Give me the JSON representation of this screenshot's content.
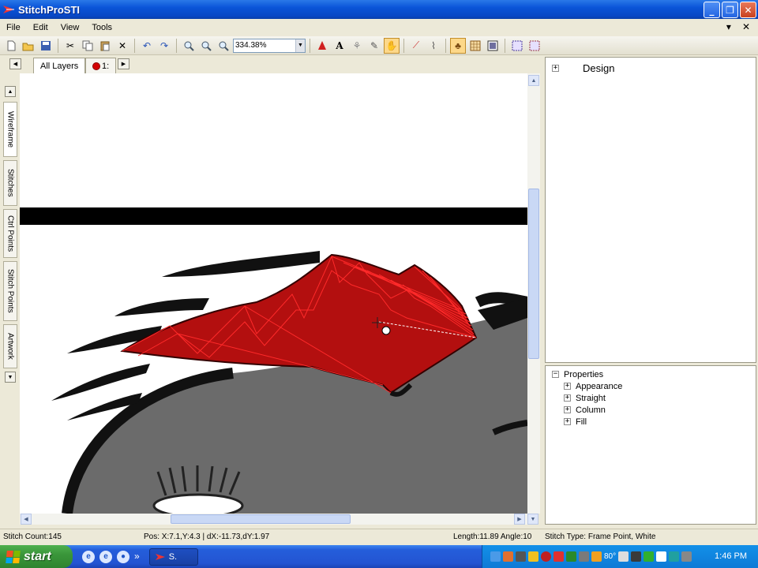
{
  "window": {
    "title": "StitchProSTI",
    "min_glyph": "_",
    "max_glyph": "❐",
    "close_glyph": "✕"
  },
  "menu": {
    "items": [
      "File",
      "Edit",
      "View",
      "Tools"
    ],
    "right_dropdown": "▾",
    "right_close": "✕"
  },
  "toolbar": {
    "zoom_value": "334.38%",
    "icons": [
      "new-icon",
      "open-icon",
      "save-icon",
      "cut-icon",
      "copy-icon",
      "paste-icon",
      "delete-icon",
      "undo-icon",
      "redo-icon",
      "zoom-in-icon",
      "zoom-out-icon",
      "zoom-fit-icon",
      "color-icon",
      "text-icon",
      "tool-a-icon",
      "tool-b-icon",
      "tool-c-icon",
      "line-icon",
      "node-icon",
      "view-a-icon",
      "view-b-icon",
      "view-c-icon",
      "grid-a-icon",
      "grid-b-icon"
    ]
  },
  "layers": {
    "tabs": [
      "All Layers",
      "1:"
    ],
    "active_tab": "All Layers"
  },
  "side_tabs": [
    "Wireframe",
    "Stitches",
    "Ctrl Points",
    "Stitch Points",
    "Artwork"
  ],
  "design_panel": {
    "root": "Design"
  },
  "properties_panel": {
    "root": "Properties",
    "items": [
      "Appearance",
      "Straight",
      "Column",
      "Fill"
    ]
  },
  "status": {
    "stitch_count": "Stitch Count:145",
    "pos": "Pos:  X:7.1,Y:4.3 | dX:-11.73,dY:1.97",
    "length": "Length:11.89 Angle:10",
    "stitch_type": "Stitch Type: Frame Point, White"
  },
  "taskbar": {
    "start_label": "start",
    "task_button": "S.",
    "chevron": "»",
    "temperature": "80°",
    "clock": "1:46 PM"
  },
  "colors": {
    "stitch_red": "#b30f0f",
    "stitch_line": "#ff2a2a",
    "design_bar": "#000000",
    "artwork_gray": "#6b6b6b"
  }
}
